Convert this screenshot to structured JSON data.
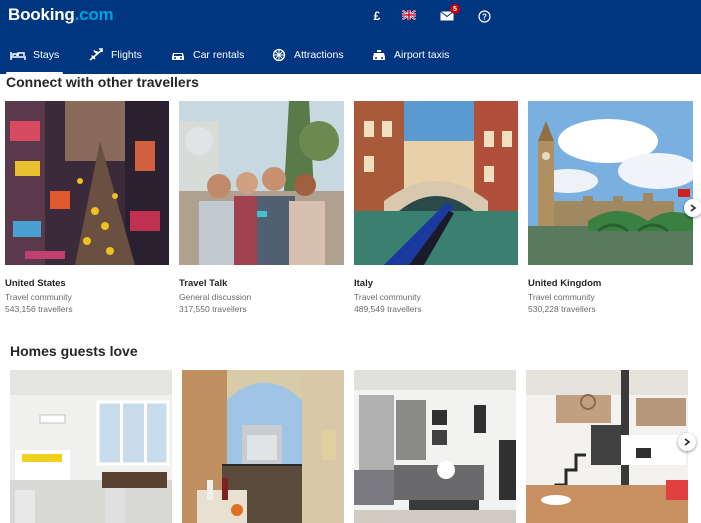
{
  "header": {
    "logo_main": "Booking",
    "logo_suffix": ".com",
    "currency": "£",
    "flag_icon": "uk-flag-icon",
    "mail_icon": "envelope-icon",
    "notification_count": "5",
    "help_icon": "question-circle-icon"
  },
  "nav": {
    "items": [
      {
        "label": "Stays",
        "icon": "bed-icon",
        "active": true
      },
      {
        "label": "Flights",
        "icon": "plane-icon",
        "active": false
      },
      {
        "label": "Car rentals",
        "icon": "car-icon",
        "active": false
      },
      {
        "label": "Attractions",
        "icon": "ferris-wheel-icon",
        "active": false
      },
      {
        "label": "Airport taxis",
        "icon": "taxi-icon",
        "active": false
      }
    ]
  },
  "community": {
    "title": "Connect with other travellers",
    "cards": [
      {
        "name": "United States",
        "type": "Travel community",
        "count": "543,156 travellers"
      },
      {
        "name": "Travel Talk",
        "type": "General discussion",
        "count": "317,550 travellers"
      },
      {
        "name": "Italy",
        "type": "Travel community",
        "count": "489,549 travellers"
      },
      {
        "name": "United Kingdom",
        "type": "Travel community",
        "count": "530,228 travellers"
      }
    ],
    "next_icon": "chevron-right-icon"
  },
  "homes": {
    "title": "Homes guests love",
    "next_icon": "chevron-right-icon"
  },
  "colors": {
    "brand_blue": "#003580",
    "logo_accent": "#00a2e0",
    "badge_red": "#cc0000"
  }
}
